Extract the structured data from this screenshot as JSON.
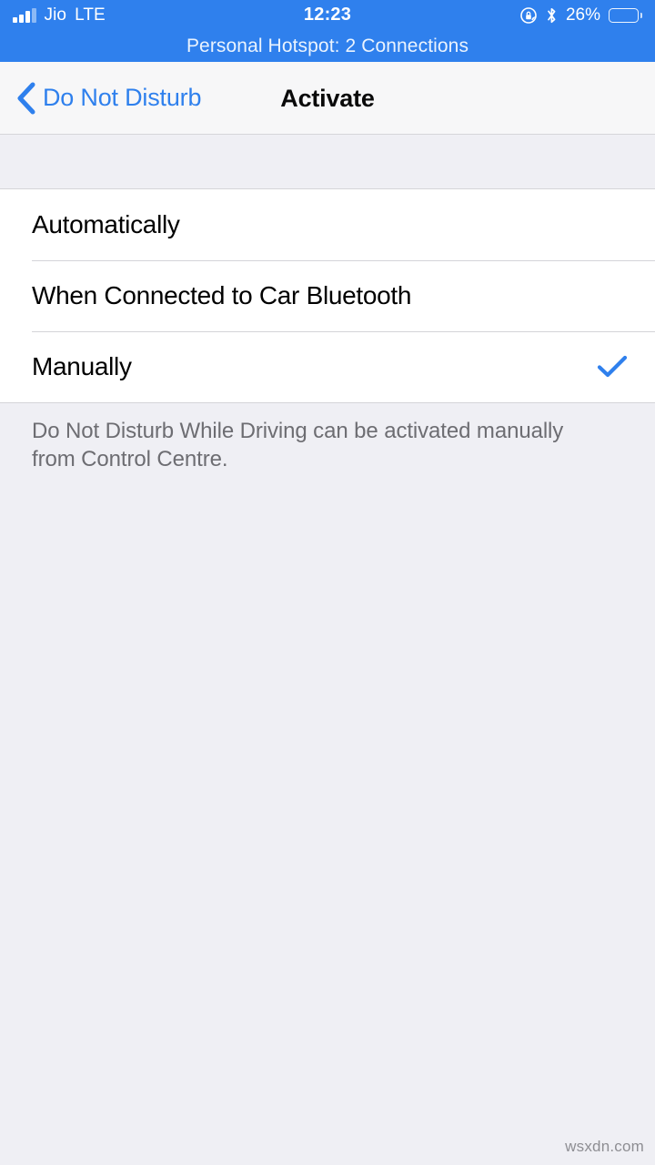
{
  "status_bar": {
    "carrier": "Jio",
    "network": "LTE",
    "time": "12:23",
    "battery_percent": "26%",
    "battery_level": 26,
    "signal_bars_total": 4,
    "signal_bars_filled": 3,
    "icons": [
      "signal-bars-icon",
      "rotation-lock-icon",
      "bluetooth-icon",
      "battery-icon"
    ],
    "hotspot_banner": "Personal Hotspot: 2 Connections",
    "background_color": "#2F80ED",
    "text_color": "#FFFFFF"
  },
  "nav_bar": {
    "back_label": "Do Not Disturb",
    "back_icon": "chevron-left-icon",
    "title": "Activate",
    "tint_color": "#2F80ED",
    "background_color": "#F7F7F8"
  },
  "main": {
    "options": [
      {
        "label": "Automatically",
        "selected": false,
        "checkmark": ""
      },
      {
        "label": "When Connected to Car Bluetooth",
        "selected": false,
        "checkmark": ""
      },
      {
        "label": "Manually",
        "selected": true,
        "checkmark": "✓"
      }
    ],
    "footer_note": "Do Not Disturb While Driving can be activated manually from Control Centre.",
    "accent_color": "#2F80ED",
    "background_color": "#EFEFF4",
    "row_background_color": "#FFFFFF",
    "footer_text_color": "#6D6D72"
  },
  "watermark": "wsxdn.com"
}
